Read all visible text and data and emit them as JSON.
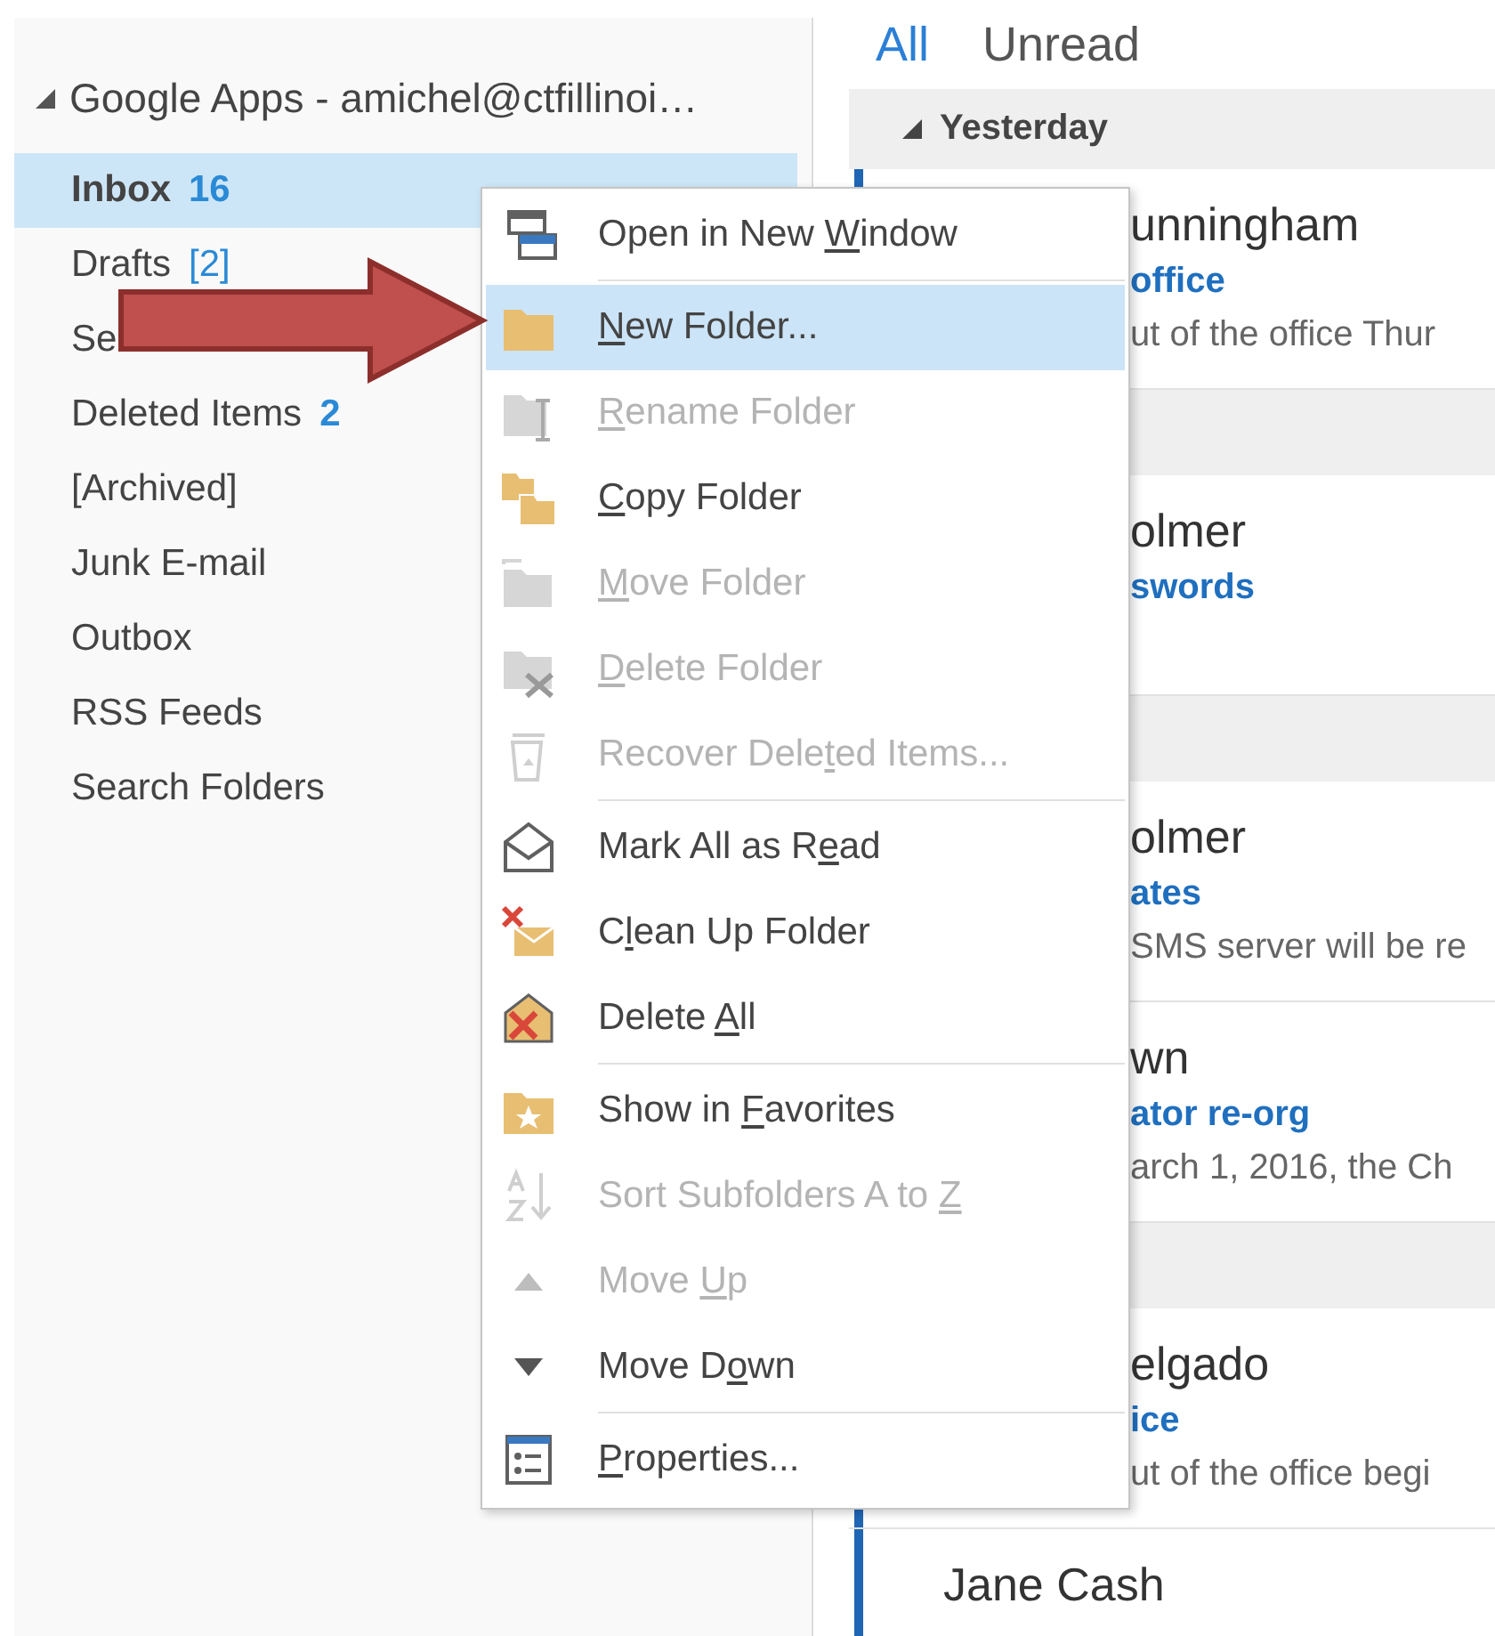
{
  "account": {
    "label": "Google Apps - amichel@ctfillinoi…",
    "expanded": true
  },
  "folders": [
    {
      "name": "Inbox",
      "count": "16",
      "count_bold": true,
      "selected": true
    },
    {
      "name": "Drafts",
      "count": "[2]",
      "count_bold": false,
      "selected": false
    },
    {
      "name": "Se",
      "selected": false
    },
    {
      "name": "Deleted Items",
      "count": "2",
      "count_bold": true,
      "selected": false
    },
    {
      "name": "[Archived]",
      "selected": false
    },
    {
      "name": "Junk E-mail",
      "selected": false
    },
    {
      "name": "Outbox",
      "selected": false
    },
    {
      "name": "RSS Feeds",
      "selected": false
    },
    {
      "name": "Search Folders",
      "selected": false
    }
  ],
  "filter_tabs": [
    {
      "label": "All",
      "selected": true
    },
    {
      "label": "Unread",
      "selected": false
    }
  ],
  "group_header": {
    "label": "Yesterday",
    "expanded": true
  },
  "messages": [
    {
      "kind": "clipped",
      "unread": true,
      "sender": "unningham",
      "subject": "office",
      "preview": "ut of the office Thur"
    },
    {
      "kind": "header"
    },
    {
      "kind": "clipped",
      "sender": "olmer",
      "subject": "swords"
    },
    {
      "kind": "header"
    },
    {
      "kind": "clipped",
      "sender": "olmer",
      "subject": "ates",
      "preview": "SMS server will be re"
    },
    {
      "kind": "clipped",
      "sender": "wn",
      "subject": "ator re-org",
      "preview": "arch 1, 2016, the Ch"
    },
    {
      "kind": "header"
    },
    {
      "kind": "clipped",
      "unread": true,
      "sender": "elgado",
      "subject": "ice",
      "preview": "ut of the office begi"
    },
    {
      "kind": "full",
      "unread": true,
      "sender": "Jane Cash"
    }
  ],
  "context_menu": {
    "groups": [
      [
        {
          "pre": "Open in New ",
          "key": "W",
          "post": "indow",
          "disabled": false,
          "selected": false
        }
      ],
      [
        {
          "key": "N",
          "post": "ew Folder...",
          "disabled": false,
          "selected": true
        },
        {
          "key": "R",
          "post": "ename Folder",
          "disabled": true,
          "selected": false
        },
        {
          "key": "C",
          "post": "opy Folder",
          "disabled": false,
          "selected": false
        },
        {
          "key": "M",
          "post": "ove Folder",
          "disabled": true,
          "selected": false
        },
        {
          "key": "D",
          "post": "elete Folder",
          "disabled": true,
          "selected": false
        },
        {
          "pre": "Recover Dele",
          "key": "t",
          "post": "ed Items...",
          "disabled": true,
          "selected": false
        }
      ],
      [
        {
          "pre": "Mark All as R",
          "key": "e",
          "post": "ad",
          "disabled": false,
          "selected": false
        },
        {
          "pre": "C",
          "key": "l",
          "post": "ean Up Folder",
          "disabled": false,
          "selected": false
        },
        {
          "pre": "Delete ",
          "key": "A",
          "post": "ll",
          "disabled": false,
          "selected": false
        }
      ],
      [
        {
          "pre": "Show in ",
          "key": "F",
          "post": "avorites",
          "disabled": false,
          "selected": false
        },
        {
          "pre": "Sort Subfolders A to ",
          "key": "Z",
          "disabled": true,
          "selected": false
        },
        {
          "pre": "Move ",
          "key": "U",
          "post": "p",
          "disabled": true,
          "selected": false
        },
        {
          "pre": "Move D",
          "key": "o",
          "post": "wn",
          "disabled": false,
          "selected": false
        }
      ],
      [
        {
          "key": "P",
          "post": "roperties...",
          "disabled": false,
          "selected": false
        }
      ]
    ]
  }
}
